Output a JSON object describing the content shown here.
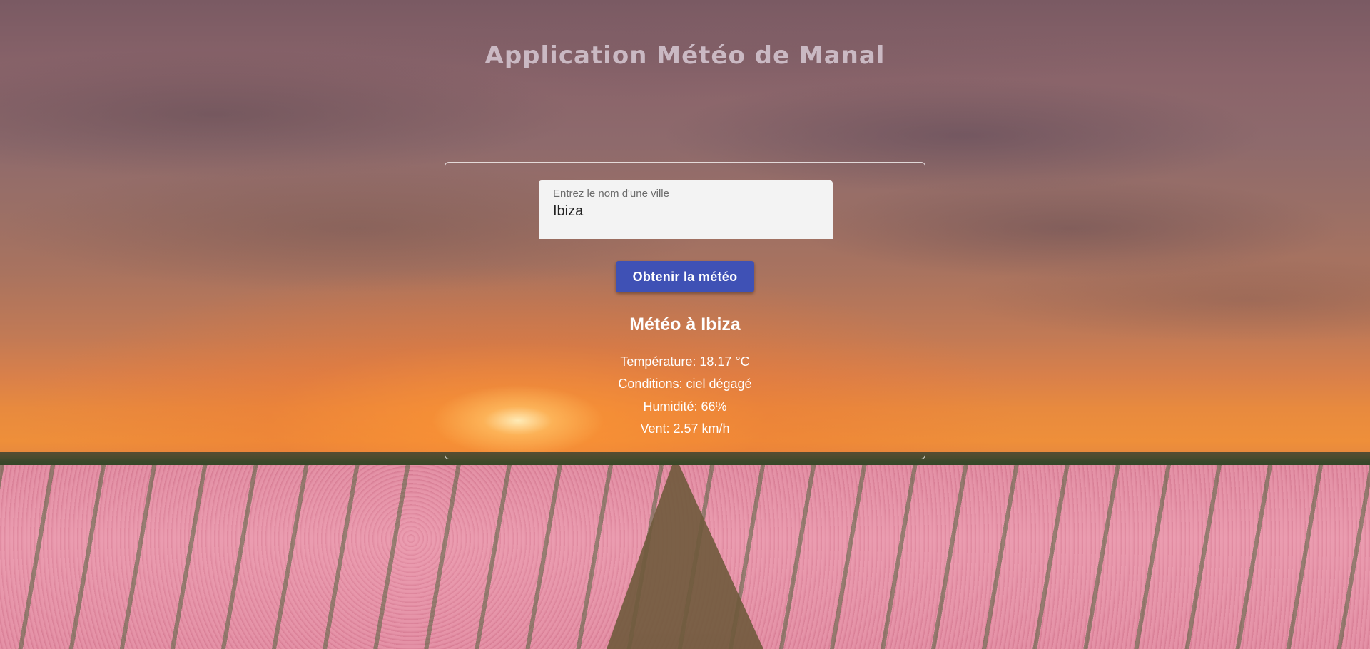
{
  "app": {
    "title": "Application Météo de Manal"
  },
  "search": {
    "label": "Entrez le nom d'une ville",
    "value": "Ibiza"
  },
  "actions": {
    "submit_label": "Obtenir la météo"
  },
  "weather": {
    "heading": "Météo à Ibiza",
    "temperature": "Température: 18.17 °C",
    "conditions": "Conditions: ciel dégagé",
    "humidity": "Humidité: 66%",
    "wind": "Vent: 2.57 km/h"
  },
  "colors": {
    "button": "#3f51b5",
    "field_background": "#f3f3f3"
  }
}
